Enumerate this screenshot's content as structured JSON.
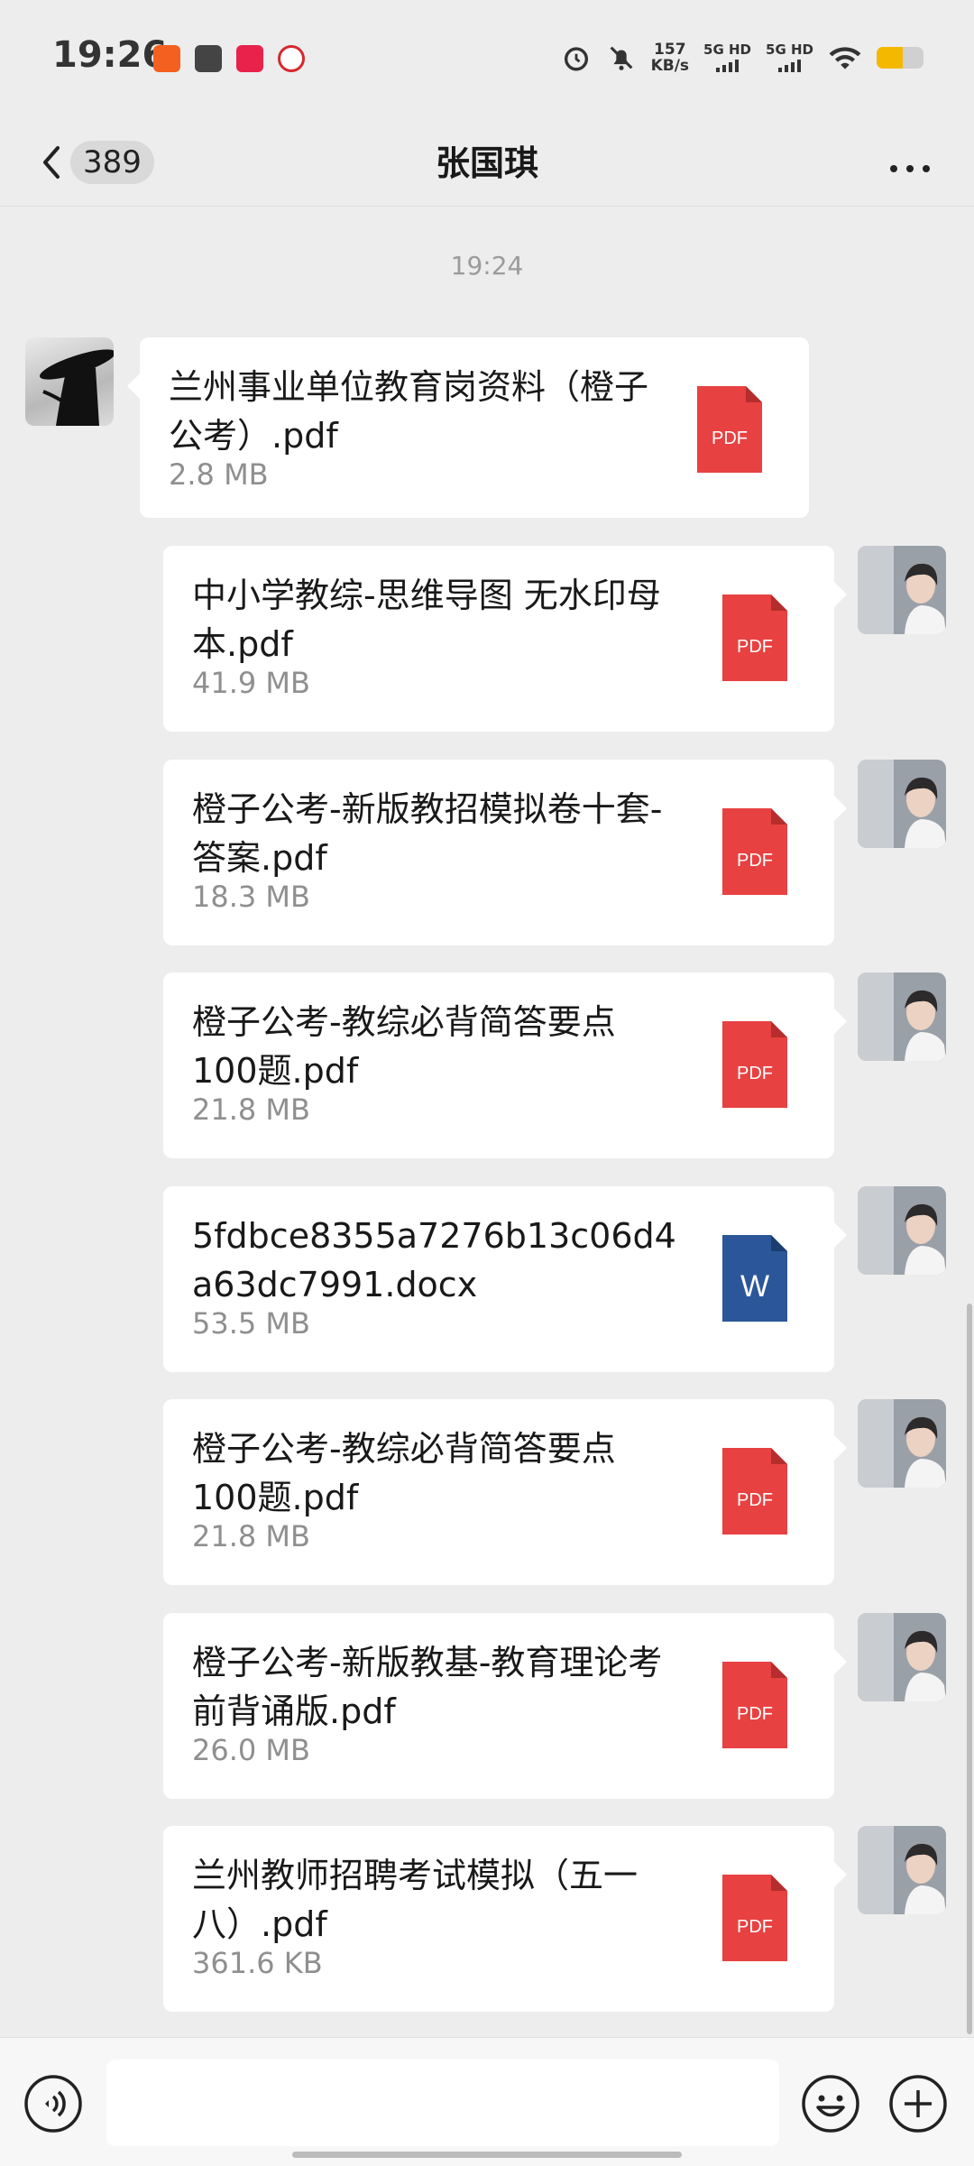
{
  "status_bar": {
    "time": "19:26",
    "net_speed_value": "157",
    "net_speed_unit": "KB/s",
    "sim1": "5G HD",
    "sim2": "5G HD",
    "battery_level": 0.55,
    "icons": [
      "alarm-icon",
      "mute-icon",
      "wifi-icon",
      "battery-icon"
    ]
  },
  "header": {
    "unread_count": "389",
    "title": "张国琪"
  },
  "chat": {
    "timestamp": "19:24",
    "messages": [
      {
        "sender": "other",
        "file_name": "兰州事业单位教育岗资料（橙子公考）.pdf",
        "file_size": "2.8 MB",
        "file_type": "PDF"
      },
      {
        "sender": "me",
        "file_name": "中小学教综-思维导图 无水印母本.pdf",
        "file_size": "41.9 MB",
        "file_type": "PDF"
      },
      {
        "sender": "me",
        "file_name": "橙子公考-新版教招模拟卷十套-答案.pdf",
        "file_size": "18.3 MB",
        "file_type": "PDF"
      },
      {
        "sender": "me",
        "file_name": "橙子公考-教综必背简答要点100题.pdf",
        "file_size": "21.8 MB",
        "file_type": "PDF"
      },
      {
        "sender": "me",
        "file_name": "5fdbce8355a7276b13c06d4a63dc7991.docx",
        "file_size": "53.5 MB",
        "file_type": "W"
      },
      {
        "sender": "me",
        "file_name": "橙子公考-教综必背简答要点100题.pdf",
        "file_size": "21.8 MB",
        "file_type": "PDF"
      },
      {
        "sender": "me",
        "file_name": "橙子公考-新版教基-教育理论考前背诵版.pdf",
        "file_size": "26.0 MB",
        "file_type": "PDF"
      },
      {
        "sender": "me",
        "file_name": "兰州教师招聘考试模拟（五一八）.pdf",
        "file_size": "361.6 KB",
        "file_type": "PDF"
      }
    ]
  },
  "colors": {
    "pdf_red": "#e84141",
    "word_blue": "#2b579a",
    "background": "#ededed",
    "bubble": "#ffffff"
  }
}
